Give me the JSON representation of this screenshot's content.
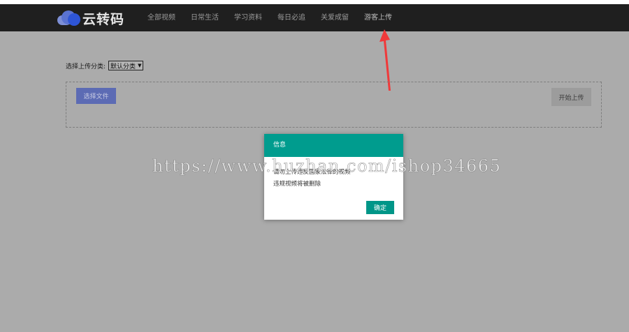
{
  "brand": {
    "name": "云转码"
  },
  "nav": {
    "items": [
      {
        "label": "全部视频"
      },
      {
        "label": "日常生活"
      },
      {
        "label": "学习资料"
      },
      {
        "label": "每日必追"
      },
      {
        "label": "关爱成留"
      },
      {
        "label": "游客上传"
      }
    ],
    "active_index": 5
  },
  "upload": {
    "category_label": "选择上传分类:",
    "category_selected": "默认分类",
    "choose_file_label": "选择文件",
    "start_upload_label": "开始上传"
  },
  "dialog": {
    "title": "信息",
    "line1": "请勿上传违反国家法律的视频",
    "line2": "违规视频将被删除",
    "ok_label": "确定"
  },
  "watermark": {
    "text": "https://www.huzhan.com/ishop34665"
  },
  "colors": {
    "navbar": "#1f1f1f",
    "overlay_background": "#ababab",
    "dialog_header": "#009c8e",
    "ok_button": "#009688",
    "choose_button": "#5c6bb4",
    "arrow": "#f0393a"
  }
}
